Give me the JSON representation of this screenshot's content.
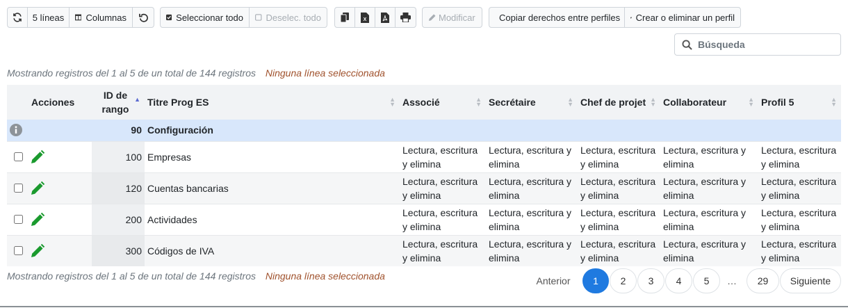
{
  "toolbar": {
    "refresh_icon": "refresh-icon",
    "lines_label": "5 líneas",
    "columns_label": "Columnas",
    "undo_icon": "undo-icon",
    "select_all_label": "Seleccionar todo",
    "deselect_all_label": "Deselec. todo",
    "modify_label": "Modificar",
    "copy_rights_label": "Copiar derechos entre perfiles",
    "create_profile_label": "Crear o eliminar un perfil"
  },
  "search": {
    "placeholder": "Búsqueda"
  },
  "summary": {
    "count_text": "Mostrando registros del 1 al 5 de un total de 144 registros",
    "selection_text": "Ninguna línea seleccionada"
  },
  "table": {
    "headers": {
      "actions": "Acciones",
      "id": "ID de rango",
      "title": "Titre Prog ES",
      "associe": "Associé",
      "secretaire": "Secrétaire",
      "chef": "Chef de projet",
      "collaborateur": "Collaborateur",
      "profil5": "Profil 5"
    },
    "group_row": {
      "id": "90",
      "title": "Configuración"
    },
    "rows": [
      {
        "id": "100",
        "title": "Empresas",
        "associe": "Lectura, escritura y elimina",
        "secretaire": "Lectura, escritura y elimina",
        "chef": "Lectura, escritura y elimina",
        "collaborateur": "Lectura, escritura y elimina",
        "profil5": "Lectura, escritura y elimina"
      },
      {
        "id": "120",
        "title": "Cuentas bancarias",
        "associe": "Lectura, escritura y elimina",
        "secretaire": "Lectura, escritura y elimina",
        "chef": "Lectura, escritura y elimina",
        "collaborateur": "Lectura, escritura y elimina",
        "profil5": "Lectura, escritura y elimina"
      },
      {
        "id": "200",
        "title": "Actividades",
        "associe": "Lectura, escritura y elimina",
        "secretaire": "Lectura, escritura y elimina",
        "chef": "Lectura, escritura y elimina",
        "collaborateur": "Lectura, escritura y elimina",
        "profil5": "Lectura, escritura y elimina"
      },
      {
        "id": "300",
        "title": "Códigos de IVA",
        "associe": "Lectura, escritura y elimina",
        "secretaire": "Lectura, escritura y elimina",
        "chef": "Lectura, escritura y elimina",
        "collaborateur": "Lectura, escritura y elimina",
        "profil5": "Lectura, escritura y elimina"
      }
    ]
  },
  "pagination": {
    "previous_label": "Anterior",
    "pages": [
      "1",
      "2",
      "3",
      "4",
      "5"
    ],
    "ellipsis": "…",
    "last_page": "29",
    "next_label": "Siguiente",
    "current_page": "1"
  },
  "colors": {
    "accent": "#1f7ae0",
    "edit_icon": "#1a9a2e",
    "group_row_bg": "#d8e7fb",
    "selection_text": "#a0522d"
  }
}
